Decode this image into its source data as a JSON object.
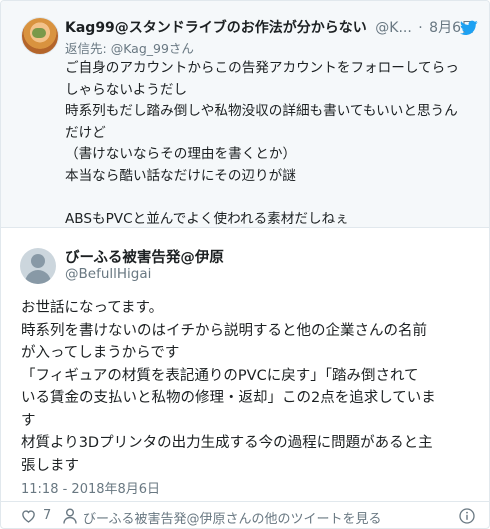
{
  "parent_tweet": {
    "display_name": "Kag99@スタンドライブのお作法が分からない",
    "handle": "@K...",
    "separator": "·",
    "date": "8月6日",
    "replying_to_prefix": "返信先: ",
    "replying_to_handle": "@Kag_99さん",
    "lines": [
      "ご自身のアカウントからこの告発アカウントをフォローしてらっ",
      "しゃらないようだし",
      "時系列もだし踏み倒しや私物没収の詳細も書いてもいいと思うん",
      "だけど",
      "（書けないならその理由を書くとか）",
      "本当なら酷い話なだけにその辺りが謎",
      "",
      "ABSもPVCと並んでよく使われる素材だしねぇ"
    ]
  },
  "main_tweet": {
    "display_name": "びーふる被害告発@伊原",
    "handle": "@BefullHigai",
    "lines": [
      "お世話になってます。",
      "時系列を書けないのはイチから説明すると他の企業さんの名前",
      "が入ってしまうからです",
      "「フィギュアの材質を表記通りのPVCに戻す」「踏み倒されて",
      "いる賃金の支払いと私物の修理・返却」この2点を追求していま",
      "す",
      "材質より3Dプリンタの出力生成する今の過程に問題があると主",
      "張します"
    ],
    "timestamp": "11:18 - 2018年8月6日"
  },
  "actions": {
    "like_count": "7",
    "view_more_label": "びーふる被害告発@伊原さんの他のツイートを見る"
  },
  "icons": {
    "twitter": "twitter-bird-icon",
    "like": "heart-icon",
    "profile": "person-icon",
    "info": "info-icon"
  },
  "colors": {
    "twitter_blue": "#1da1f2",
    "secondary_text": "#697882",
    "parent_background": "#f5f8fa",
    "border": "#e1e8ed"
  }
}
